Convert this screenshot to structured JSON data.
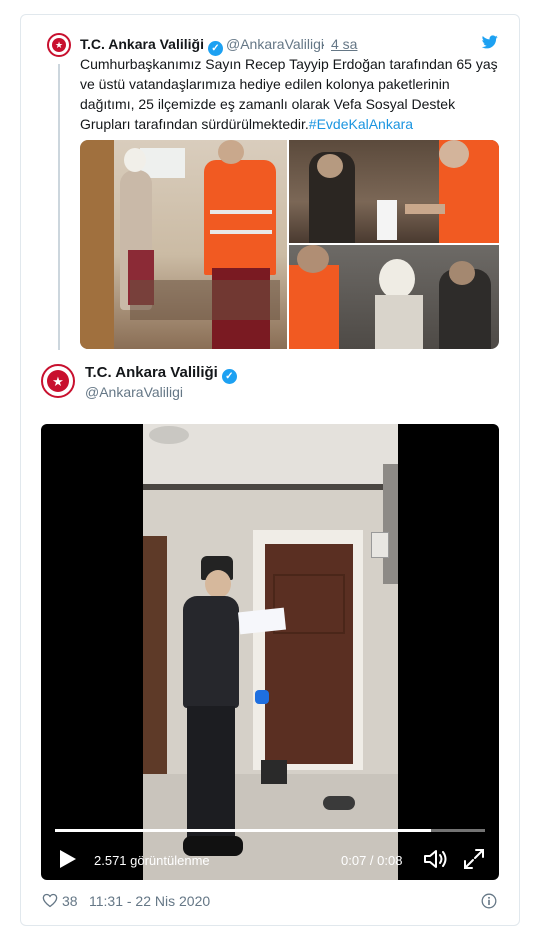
{
  "quoted_tweet": {
    "name": "T.C. Ankara Valiliği",
    "handle": "@AnkaraValiligi",
    "separator": "·",
    "time": "4 sa",
    "text": "Cumhurbaşkanımız Sayın Recep Tayyip Erdoğan tarafından 65 yaş ve üstü vatandaşlarımıza hediye edilen kolonya paketlerinin dağıtımı, 25 ilçemizde eş zamanlı olarak Vefa  Sosyal Destek Grupları tarafından sürdürülmektedir.",
    "hashtag": "#EvdeKalAnkara",
    "icons": {
      "verified": "verified-badge-icon",
      "platform": "twitter-bird-icon"
    }
  },
  "main_tweet": {
    "name": "T.C. Ankara Valiliği",
    "handle": "@AnkaraValiligi",
    "verified_icon": "verified-badge-icon",
    "avatar_icon": "governorship-seal-icon"
  },
  "video": {
    "views": "2.571 görüntülenme",
    "time": "0:07 / 0:08",
    "progress": 0.875,
    "icons": {
      "play": "play-icon",
      "volume": "volume-icon",
      "fullscreen": "fullscreen-icon"
    }
  },
  "footer": {
    "likes": "38",
    "timestamp": "11:31 - 22 Nis 2020",
    "icons": {
      "like": "heart-icon",
      "info": "info-icon"
    }
  },
  "colors": {
    "brand_blue": "#1da1f2",
    "link": "#1b95e0",
    "secondary_text": "#657786",
    "seal_red": "#c8102e",
    "border": "#e1e8ed"
  }
}
